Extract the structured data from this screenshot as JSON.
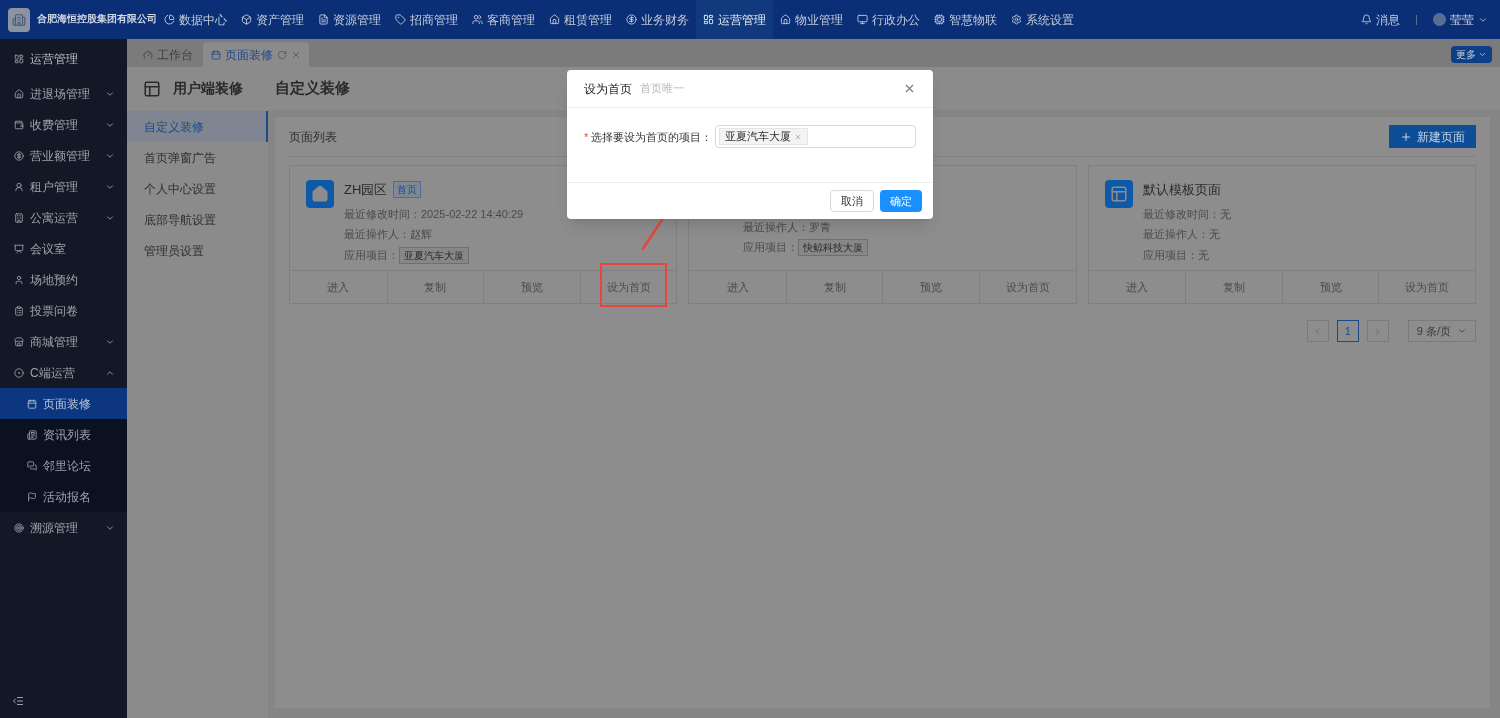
{
  "topbar": {
    "company": "合肥海恒控股集团有限公司",
    "nav": [
      {
        "label": "数据中心",
        "selected": false
      },
      {
        "label": "资产管理",
        "selected": false
      },
      {
        "label": "资源管理",
        "selected": false
      },
      {
        "label": "招商管理",
        "selected": false
      },
      {
        "label": "客商管理",
        "selected": false
      },
      {
        "label": "租赁管理",
        "selected": false
      },
      {
        "label": "业务财务",
        "selected": false
      },
      {
        "label": "运营管理",
        "selected": true
      },
      {
        "label": "物业管理",
        "selected": false
      },
      {
        "label": "行政办公",
        "selected": false
      },
      {
        "label": "智慧物联",
        "selected": false
      },
      {
        "label": "系统设置",
        "selected": false
      }
    ],
    "messages": "消息",
    "user": "莹莹"
  },
  "sidebar": {
    "title": "运营管理",
    "items": [
      {
        "label": "进退场管理",
        "kind": "group",
        "expanded": false
      },
      {
        "label": "收费管理",
        "kind": "group",
        "expanded": false
      },
      {
        "label": "营业额管理",
        "kind": "group",
        "expanded": false
      },
      {
        "label": "租户管理",
        "kind": "group",
        "expanded": false
      },
      {
        "label": "公寓运营",
        "kind": "group",
        "expanded": false
      },
      {
        "label": "会议室",
        "kind": "link"
      },
      {
        "label": "场地预约",
        "kind": "link"
      },
      {
        "label": "投票问卷",
        "kind": "link"
      },
      {
        "label": "商城管理",
        "kind": "group",
        "expanded": false
      },
      {
        "label": "C端运营",
        "kind": "group",
        "expanded": true,
        "children": [
          {
            "label": "页面装修",
            "selected": true
          },
          {
            "label": "资讯列表",
            "selected": false
          },
          {
            "label": "邻里论坛",
            "selected": false
          },
          {
            "label": "活动报名",
            "selected": false
          }
        ]
      },
      {
        "label": "溯源管理",
        "kind": "group",
        "expanded": false
      }
    ]
  },
  "tabs": [
    {
      "label": "工作台",
      "selected": false
    },
    {
      "label": "页面装修",
      "selected": true
    }
  ],
  "more": "更多",
  "header": {
    "section": "用户端装修",
    "title": "自定义装修"
  },
  "submenu": [
    {
      "label": "自定义装修",
      "selected": true
    },
    {
      "label": "首页弹窗广告",
      "selected": false
    },
    {
      "label": "个人中心设置",
      "selected": false
    },
    {
      "label": "底部导航设置",
      "selected": false
    },
    {
      "label": "管理员设置",
      "selected": false
    }
  ],
  "panel": {
    "title": "页面列表",
    "new_button": "新建页面"
  },
  "cards": [
    {
      "title": "ZH园区",
      "badge": "首页",
      "modified": "最近修改时间：2025-02-22 14:40:29",
      "operator": "最近操作人：赵辉",
      "project_label": "应用项目：",
      "project": "亚夏汽车大厦",
      "actions": [
        "进入",
        "复制",
        "预览",
        "设为首页"
      ]
    },
    {
      "operator": "最近操作人：罗青",
      "project_label": "应用项目：",
      "project": "快鲸科技大厦",
      "actions": [
        "进入",
        "复制",
        "预览",
        "设为首页"
      ]
    },
    {
      "title": "默认模板页面",
      "modified": "最近修改时间：无",
      "operator": "最近操作人：无",
      "project_label": "应用项目：无",
      "actions": [
        "进入",
        "复制",
        "预览",
        "设为首页"
      ]
    }
  ],
  "pagination": {
    "pages": [
      {
        "label": "1",
        "selected": true
      }
    ],
    "page_size": "9 条/页"
  },
  "modal": {
    "title": "设为首页",
    "subtitle": "首页唯一",
    "field_label": "选择要设为首页的项目：",
    "required_mark": "*",
    "tags": [
      "亚夏汽车大厦"
    ],
    "cancel": "取消",
    "ok": "确定"
  }
}
